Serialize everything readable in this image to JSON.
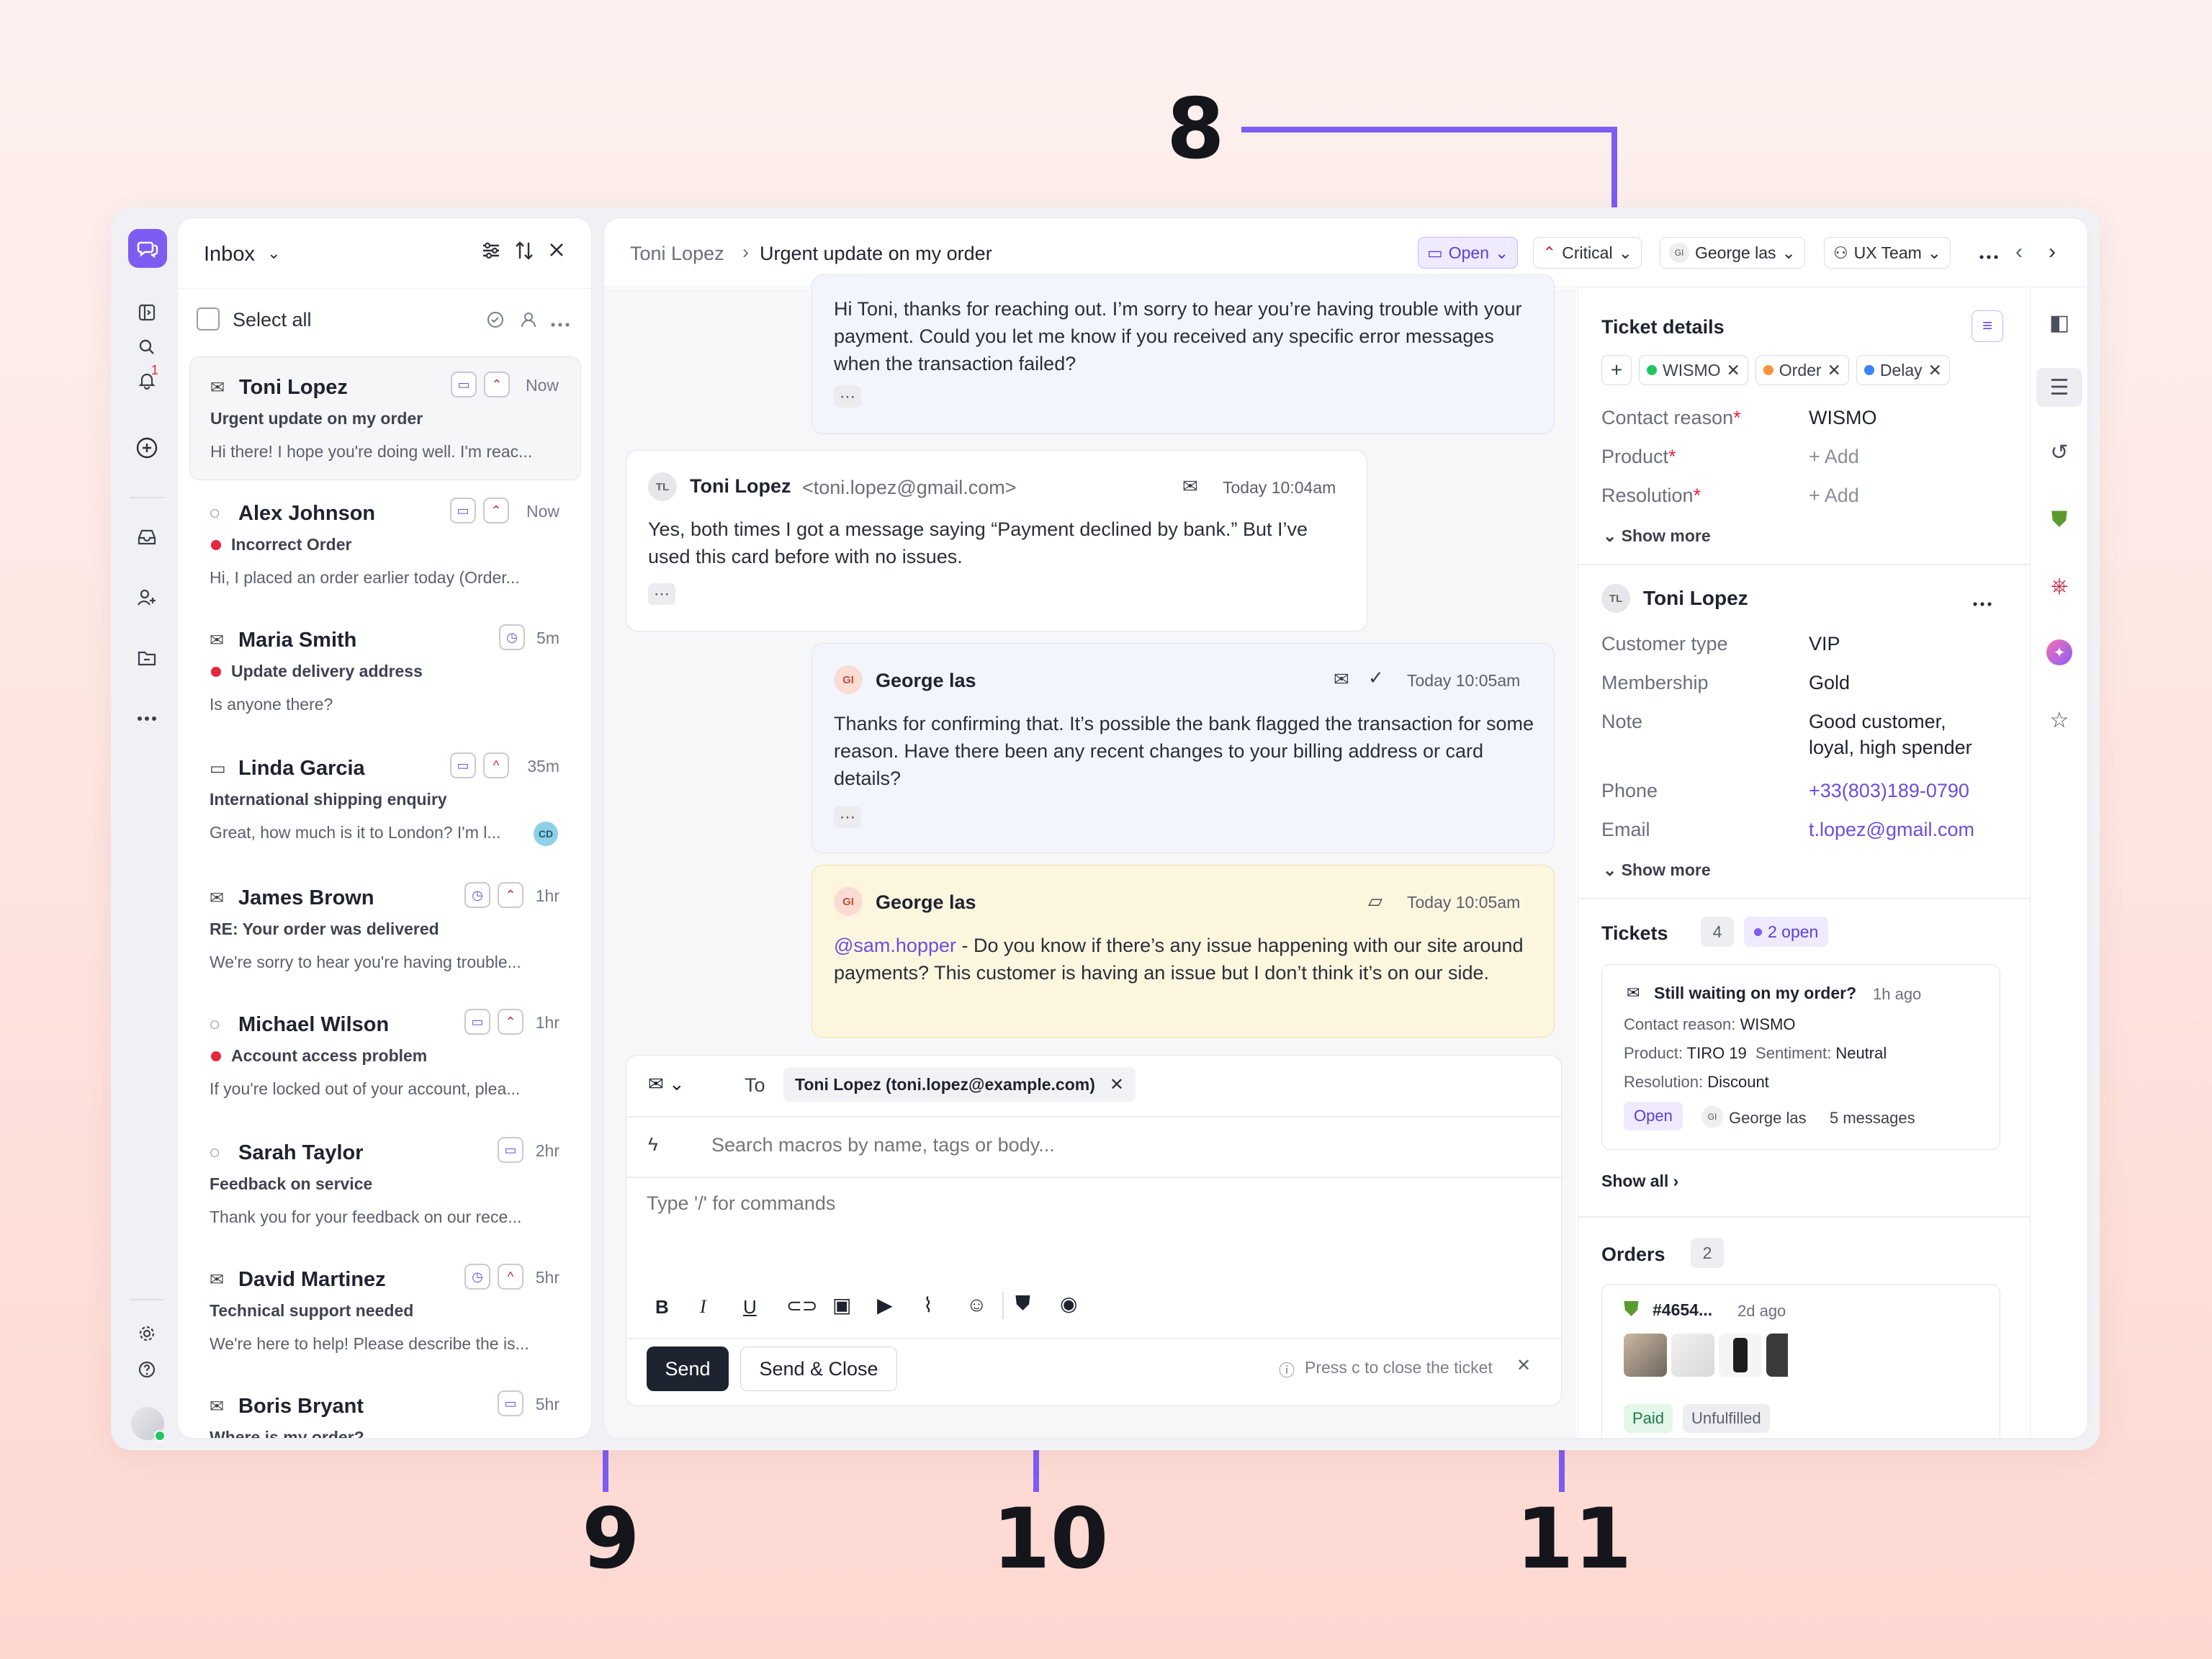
{
  "callouts": {
    "c8": "8",
    "c9": "9",
    "c10": "10",
    "c11": "11"
  },
  "colors": {
    "accent": "#7d5cf2",
    "danger": "#e5263f",
    "note_bg": "#fdf6de",
    "agent_bg": "#f3f5fd"
  },
  "rail": {
    "icons": [
      "chat-logo-icon",
      "sidebar-toggle-icon",
      "search-icon",
      "bell-icon",
      "plus-circle-icon",
      "inbox-icon",
      "user-plus-icon",
      "folder-icon",
      "more-icon",
      "settings-icon",
      "help-icon"
    ],
    "notif_count": "1"
  },
  "inbox": {
    "title": "Inbox",
    "select_all": "Select all",
    "conversations": [
      {
        "name": "Toni Lopez",
        "subject": "Urgent update on my order",
        "preview": "Hi there! I hope you're doing well. I'm reac...",
        "time": "Now",
        "channel": "email",
        "unread": false
      },
      {
        "name": "Alex Johnson",
        "subject": "Incorrect Order",
        "preview": "Hi, I placed an order earlier today (Order...",
        "time": "Now",
        "channel": "chat",
        "unread": true
      },
      {
        "name": "Maria Smith",
        "subject": "Update delivery address",
        "preview": "Is anyone there?",
        "time": "5m",
        "channel": "email",
        "unread": true
      },
      {
        "name": "Linda Garcia",
        "subject": "International shipping enquiry",
        "preview": "Great, how much is it to London? I'm l...",
        "time": "35m",
        "channel": "sms",
        "unread": false,
        "initials": "CD"
      },
      {
        "name": "James Brown",
        "subject": "RE: Your order was delivered",
        "preview": "We're sorry to hear you're having trouble...",
        "time": "1hr",
        "channel": "email",
        "unread": false
      },
      {
        "name": "Michael Wilson",
        "subject": "Account access problem",
        "preview": "If you're locked out of your account, plea...",
        "time": "1hr",
        "channel": "chat",
        "unread": true
      },
      {
        "name": "Sarah Taylor",
        "subject": "Feedback on service",
        "preview": "Thank you for your feedback on our rece...",
        "time": "2hr",
        "channel": "chat",
        "unread": false
      },
      {
        "name": "David Martinez",
        "subject": "Technical support needed",
        "preview": "We're here to help! Please describe the is...",
        "time": "5hr",
        "channel": "email",
        "unread": false
      },
      {
        "name": "Boris Bryant",
        "subject": "Where is my order?",
        "preview": "",
        "time": "5hr",
        "channel": "email",
        "unread": false
      }
    ]
  },
  "header": {
    "breadcrumb_parent": "Toni Lopez",
    "breadcrumb_current": "Urgent update on my order",
    "status": "Open",
    "priority": "Critical",
    "assignee_initials": "GI",
    "assignee": "George las",
    "team": "UX Team"
  },
  "thread": {
    "m1_body": "Hi Toni, thanks for reaching out. I’m sorry to hear you’re having trouble with your payment. Could you let me know if you received any specific error messages when the transaction failed?",
    "m2": {
      "initials": "TL",
      "sender": "Toni Lopez",
      "email": "<toni.lopez@gmail.com>",
      "time": "Today 10:04am",
      "body": "Yes, both times I got a message saying “Payment declined by bank.” But I’ve used this card before with no issues."
    },
    "m3": {
      "initials": "GI",
      "sender": "George las",
      "time": "Today 10:05am",
      "body": "Thanks for confirming that. It’s possible the bank flagged the transaction for some reason. Have there been any recent changes to your billing address or card details?"
    },
    "m4": {
      "initials": "GI",
      "sender": "George las",
      "time": "Today 10:05am",
      "mention": "@sam.hopper",
      "body": " - Do you know if there’s any issue happening with our site around payments? This customer is having an issue but I don’t think it’s on our side."
    }
  },
  "composer": {
    "to_label": "To",
    "recipient": "Toni Lopez (toni.lopez@example.com)",
    "macro_placeholder": "Search macros by name, tags or body...",
    "body_placeholder": "Type '/' for commands",
    "send": "Send",
    "send_close": "Send & Close",
    "hint": "Press c to close the ticket"
  },
  "details": {
    "title": "Ticket details",
    "tags": [
      {
        "label": "WISMO",
        "color": "#22c55e"
      },
      {
        "label": "Order",
        "color": "#fb923c"
      },
      {
        "label": "Delay",
        "color": "#3b82f6"
      }
    ],
    "contact_reason_label": "Contact reason",
    "contact_reason": "WISMO",
    "product_label": "Product",
    "product": "+ Add",
    "resolution_label": "Resolution",
    "resolution": "+ Add",
    "show_more": "Show more",
    "customer": {
      "initials": "TL",
      "name": "Toni Lopez",
      "type_label": "Customer type",
      "type": "VIP",
      "membership_label": "Membership",
      "membership": "Gold",
      "note_label": "Note",
      "note_l1": "Good customer,",
      "note_l2": "loyal, high spender",
      "phone_label": "Phone",
      "phone": "+33(803)189-0790",
      "email_label": "Email",
      "email": "t.lopez@gmail.com",
      "show_more": "Show more"
    },
    "tickets": {
      "title": "Tickets",
      "count": "4",
      "open": "2 open",
      "card": {
        "subject": "Still waiting on my order?",
        "age": "1h ago",
        "contact_label": "Contact reason:",
        "contact": "WISMO",
        "product_label": "Product:",
        "product": "TIRO 19",
        "sentiment_label": "Sentiment:",
        "sentiment": "Neutral",
        "resolution_label": "Resolution:",
        "resolution": "Discount",
        "status": "Open",
        "agent_initials": "GI",
        "agent": "George las",
        "messages": "5 messages"
      },
      "show_all": "Show all"
    },
    "orders": {
      "title": "Orders",
      "count": "2",
      "order_id": "#4654...",
      "age": "2d ago",
      "paid": "Paid",
      "fulfillment": "Unfulfilled"
    }
  }
}
